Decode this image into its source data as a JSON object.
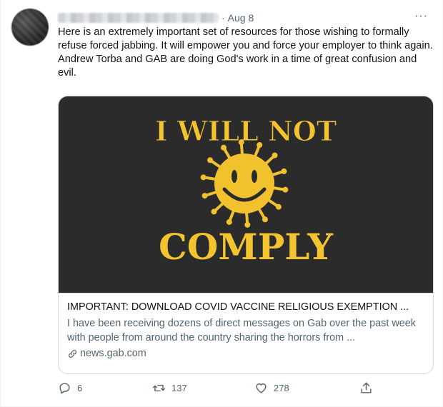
{
  "tweet": {
    "separator": "·",
    "date": "Aug 8",
    "more_label": "···",
    "text": "Here is an extremely important set of resources for those wishing to formally refuse forced jabbing. It will empower you and force your employer to think again. Andrew Torba and GAB are doing God's work in a time of great confusion and evil."
  },
  "card": {
    "image_text_top": "I WILL NOT",
    "image_text_bottom": "COMPLY",
    "title": "IMPORTANT: DOWNLOAD COVID VACCINE RELIGIOUS EXEMPTION ...",
    "description": "I have been receiving dozens of direct messages on Gab over the past week with people from around the country sharing the horrors from ...",
    "domain": "news.gab.com",
    "colors": {
      "background": "#2b2b2b",
      "text": "#f4c430",
      "face": "#f2c12e"
    }
  },
  "actions": {
    "reply_count": "6",
    "retweet_count": "137",
    "like_count": "278"
  },
  "icons": [
    "more-icon",
    "link-icon",
    "reply-icon",
    "retweet-icon",
    "like-icon",
    "share-icon"
  ]
}
